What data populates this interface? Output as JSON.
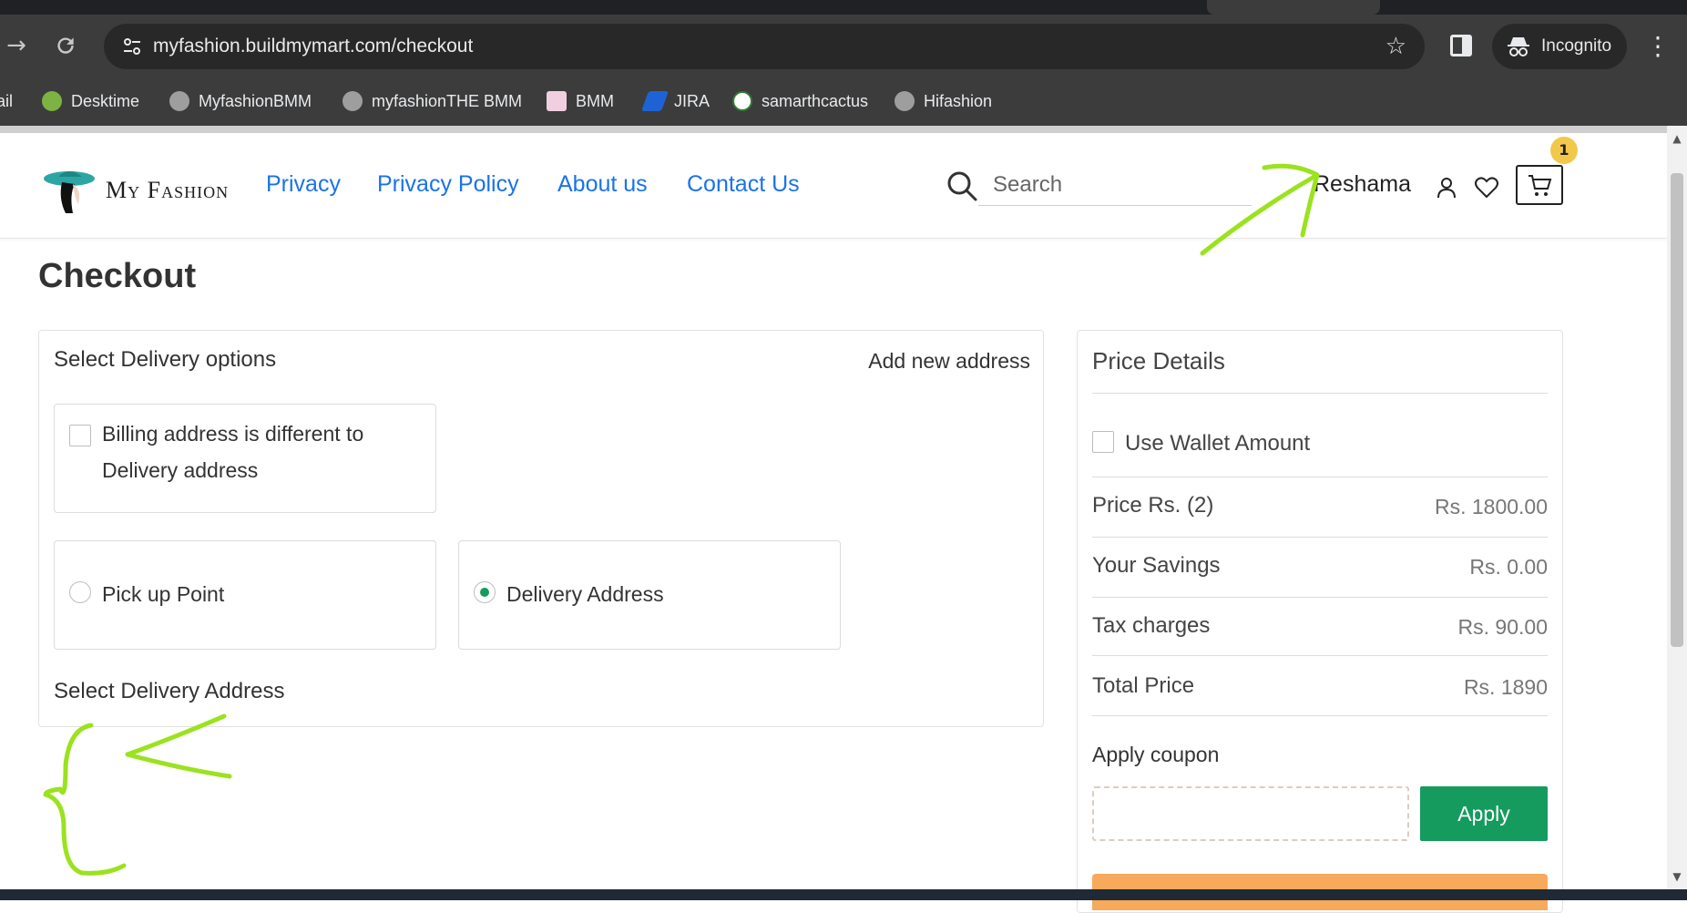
{
  "browser": {
    "url": "myfashion.buildmymart.com/checkout",
    "incognito_label": "Incognito",
    "bookmarks": [
      {
        "label": "ail",
        "color": "#ffffff"
      },
      {
        "label": "Desktime",
        "color": "#7cb342"
      },
      {
        "label": "MyfashionBMM",
        "color": "#9e9e9e"
      },
      {
        "label": "myfashionTHE BMM",
        "color": "#9e9e9e"
      },
      {
        "label": "BMM",
        "color": "#c2185b"
      },
      {
        "label": "JIRA",
        "color": "#1e63d6"
      },
      {
        "label": "samarthcactus",
        "color": "#2e7d32"
      },
      {
        "label": "Hifashion",
        "color": "#9e9e9e"
      }
    ]
  },
  "header": {
    "logo_text": "My Fashion",
    "nav": [
      "Privacy",
      "Privacy Policy",
      "About us",
      "Contact Us"
    ],
    "search_placeholder": "Search",
    "user_name": "Reshama",
    "cart_count": "1"
  },
  "page": {
    "title": "Checkout"
  },
  "delivery": {
    "heading": "Select Delivery options",
    "add_new_address": "Add new address",
    "billing_label_line1": "Billing address is different to",
    "billing_label_line2": "Delivery address",
    "billing_checked": false,
    "pickup_label": "Pick up Point",
    "delivery_label": "Delivery Address",
    "selected_option": "Delivery Address",
    "select_address_heading": "Select Delivery Address"
  },
  "price_details": {
    "title": "Price Details",
    "wallet_label": "Use Wallet Amount",
    "wallet_checked": false,
    "rows": [
      {
        "label": "Price Rs. (2)",
        "value": "Rs. 1800.00"
      },
      {
        "label": "Your Savings",
        "value": "Rs. 0.00"
      },
      {
        "label": "Tax charges",
        "value": "Rs. 90.00"
      },
      {
        "label": "Total Price",
        "value": "Rs. 1890"
      }
    ],
    "coupon_title": "Apply coupon",
    "coupon_value": "",
    "apply_label": "Apply"
  },
  "colors": {
    "accent_green": "#159b5e",
    "link_blue": "#1a73e8",
    "annotation_green": "#9be21f",
    "badge_yellow": "#f2c84b",
    "orange_button": "#f7a95c"
  },
  "icons": [
    "forward-arrow-icon",
    "reload-icon",
    "site-settings-icon",
    "star-icon",
    "side-panel-icon",
    "incognito-icon",
    "menu-dots-icon",
    "search-icon",
    "user-icon",
    "heart-icon",
    "cart-icon"
  ]
}
